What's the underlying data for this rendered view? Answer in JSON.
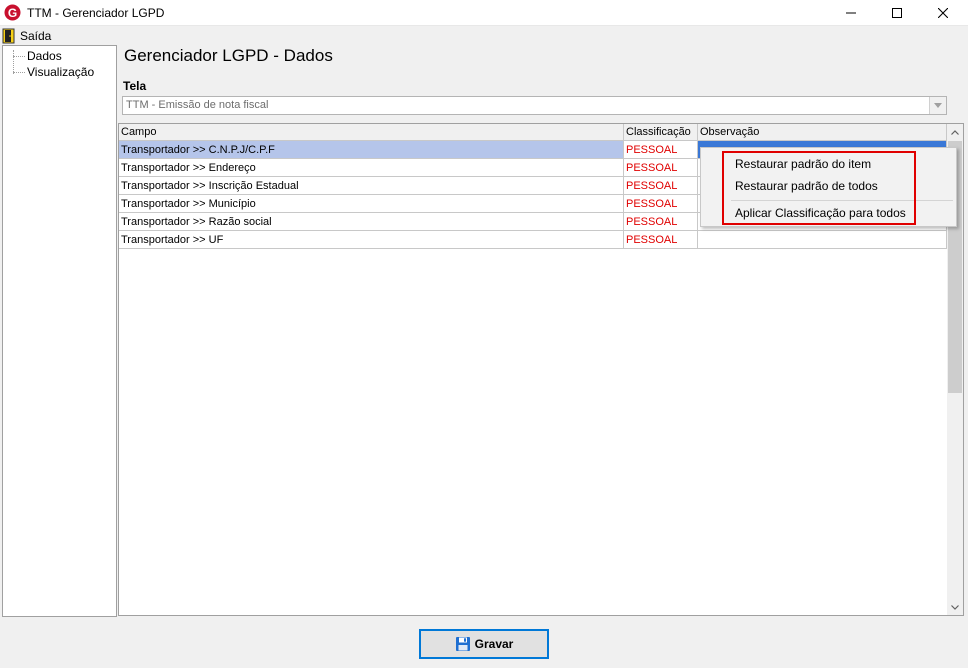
{
  "window": {
    "title": "TTM - Gerenciador LGPD"
  },
  "menu": {
    "saida_label": "Saída"
  },
  "tree": {
    "items": [
      {
        "label": "Dados"
      },
      {
        "label": "Visualização"
      }
    ]
  },
  "main": {
    "title": "Gerenciador LGPD - Dados",
    "tela_label": "Tela",
    "tela_value": "TTM - Emissão de nota fiscal"
  },
  "grid": {
    "columns": [
      "Campo",
      "Classificação",
      "Observação"
    ],
    "rows": [
      {
        "campo": "Transportador >> C.N.P.J/C.P.F",
        "classificacao": "PESSOAL",
        "observacao": "",
        "selected": true
      },
      {
        "campo": "Transportador >> Endereço",
        "classificacao": "PESSOAL",
        "observacao": ""
      },
      {
        "campo": "Transportador >> Inscrição Estadual",
        "classificacao": "PESSOAL",
        "observacao": ""
      },
      {
        "campo": "Transportador >> Município",
        "classificacao": "PESSOAL",
        "observacao": ""
      },
      {
        "campo": "Transportador >> Razão social",
        "classificacao": "PESSOAL",
        "observacao": ""
      },
      {
        "campo": "Transportador >> UF",
        "classificacao": "PESSOAL",
        "observacao": ""
      }
    ]
  },
  "context_menu": {
    "items": [
      "Restaurar padrão do item",
      "Restaurar padrão de todos",
      "Aplicar Classificação para todos"
    ]
  },
  "footer": {
    "save_label": "Gravar"
  },
  "colors": {
    "classification_text": "#e00000",
    "selected_row": "#b5c5ea",
    "selected_cell": "#3a78d7",
    "highlight_box": "#e00000",
    "button_border": "#0078d7"
  }
}
